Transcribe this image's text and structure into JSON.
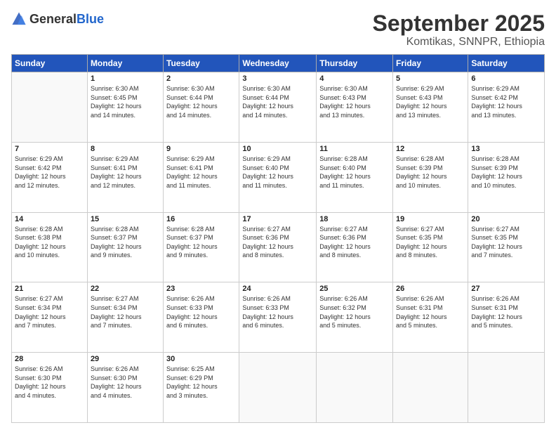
{
  "logo": {
    "general": "General",
    "blue": "Blue"
  },
  "header": {
    "month": "September 2025",
    "location": "Komtikas, SNNPR, Ethiopia"
  },
  "weekdays": [
    "Sunday",
    "Monday",
    "Tuesday",
    "Wednesday",
    "Thursday",
    "Friday",
    "Saturday"
  ],
  "weeks": [
    [
      {
        "day": "",
        "sunrise": "",
        "sunset": "",
        "daylight": ""
      },
      {
        "day": "1",
        "sunrise": "Sunrise: 6:30 AM",
        "sunset": "Sunset: 6:45 PM",
        "daylight": "Daylight: 12 hours and 14 minutes."
      },
      {
        "day": "2",
        "sunrise": "Sunrise: 6:30 AM",
        "sunset": "Sunset: 6:44 PM",
        "daylight": "Daylight: 12 hours and 14 minutes."
      },
      {
        "day": "3",
        "sunrise": "Sunrise: 6:30 AM",
        "sunset": "Sunset: 6:44 PM",
        "daylight": "Daylight: 12 hours and 14 minutes."
      },
      {
        "day": "4",
        "sunrise": "Sunrise: 6:30 AM",
        "sunset": "Sunset: 6:43 PM",
        "daylight": "Daylight: 12 hours and 13 minutes."
      },
      {
        "day": "5",
        "sunrise": "Sunrise: 6:29 AM",
        "sunset": "Sunset: 6:43 PM",
        "daylight": "Daylight: 12 hours and 13 minutes."
      },
      {
        "day": "6",
        "sunrise": "Sunrise: 6:29 AM",
        "sunset": "Sunset: 6:42 PM",
        "daylight": "Daylight: 12 hours and 13 minutes."
      }
    ],
    [
      {
        "day": "7",
        "sunrise": "Sunrise: 6:29 AM",
        "sunset": "Sunset: 6:42 PM",
        "daylight": "Daylight: 12 hours and 12 minutes."
      },
      {
        "day": "8",
        "sunrise": "Sunrise: 6:29 AM",
        "sunset": "Sunset: 6:41 PM",
        "daylight": "Daylight: 12 hours and 12 minutes."
      },
      {
        "day": "9",
        "sunrise": "Sunrise: 6:29 AM",
        "sunset": "Sunset: 6:41 PM",
        "daylight": "Daylight: 12 hours and 11 minutes."
      },
      {
        "day": "10",
        "sunrise": "Sunrise: 6:29 AM",
        "sunset": "Sunset: 6:40 PM",
        "daylight": "Daylight: 12 hours and 11 minutes."
      },
      {
        "day": "11",
        "sunrise": "Sunrise: 6:28 AM",
        "sunset": "Sunset: 6:40 PM",
        "daylight": "Daylight: 12 hours and 11 minutes."
      },
      {
        "day": "12",
        "sunrise": "Sunrise: 6:28 AM",
        "sunset": "Sunset: 6:39 PM",
        "daylight": "Daylight: 12 hours and 10 minutes."
      },
      {
        "day": "13",
        "sunrise": "Sunrise: 6:28 AM",
        "sunset": "Sunset: 6:39 PM",
        "daylight": "Daylight: 12 hours and 10 minutes."
      }
    ],
    [
      {
        "day": "14",
        "sunrise": "Sunrise: 6:28 AM",
        "sunset": "Sunset: 6:38 PM",
        "daylight": "Daylight: 12 hours and 10 minutes."
      },
      {
        "day": "15",
        "sunrise": "Sunrise: 6:28 AM",
        "sunset": "Sunset: 6:37 PM",
        "daylight": "Daylight: 12 hours and 9 minutes."
      },
      {
        "day": "16",
        "sunrise": "Sunrise: 6:28 AM",
        "sunset": "Sunset: 6:37 PM",
        "daylight": "Daylight: 12 hours and 9 minutes."
      },
      {
        "day": "17",
        "sunrise": "Sunrise: 6:27 AM",
        "sunset": "Sunset: 6:36 PM",
        "daylight": "Daylight: 12 hours and 8 minutes."
      },
      {
        "day": "18",
        "sunrise": "Sunrise: 6:27 AM",
        "sunset": "Sunset: 6:36 PM",
        "daylight": "Daylight: 12 hours and 8 minutes."
      },
      {
        "day": "19",
        "sunrise": "Sunrise: 6:27 AM",
        "sunset": "Sunset: 6:35 PM",
        "daylight": "Daylight: 12 hours and 8 minutes."
      },
      {
        "day": "20",
        "sunrise": "Sunrise: 6:27 AM",
        "sunset": "Sunset: 6:35 PM",
        "daylight": "Daylight: 12 hours and 7 minutes."
      }
    ],
    [
      {
        "day": "21",
        "sunrise": "Sunrise: 6:27 AM",
        "sunset": "Sunset: 6:34 PM",
        "daylight": "Daylight: 12 hours and 7 minutes."
      },
      {
        "day": "22",
        "sunrise": "Sunrise: 6:27 AM",
        "sunset": "Sunset: 6:34 PM",
        "daylight": "Daylight: 12 hours and 7 minutes."
      },
      {
        "day": "23",
        "sunrise": "Sunrise: 6:26 AM",
        "sunset": "Sunset: 6:33 PM",
        "daylight": "Daylight: 12 hours and 6 minutes."
      },
      {
        "day": "24",
        "sunrise": "Sunrise: 6:26 AM",
        "sunset": "Sunset: 6:33 PM",
        "daylight": "Daylight: 12 hours and 6 minutes."
      },
      {
        "day": "25",
        "sunrise": "Sunrise: 6:26 AM",
        "sunset": "Sunset: 6:32 PM",
        "daylight": "Daylight: 12 hours and 5 minutes."
      },
      {
        "day": "26",
        "sunrise": "Sunrise: 6:26 AM",
        "sunset": "Sunset: 6:31 PM",
        "daylight": "Daylight: 12 hours and 5 minutes."
      },
      {
        "day": "27",
        "sunrise": "Sunrise: 6:26 AM",
        "sunset": "Sunset: 6:31 PM",
        "daylight": "Daylight: 12 hours and 5 minutes."
      }
    ],
    [
      {
        "day": "28",
        "sunrise": "Sunrise: 6:26 AM",
        "sunset": "Sunset: 6:30 PM",
        "daylight": "Daylight: 12 hours and 4 minutes."
      },
      {
        "day": "29",
        "sunrise": "Sunrise: 6:26 AM",
        "sunset": "Sunset: 6:30 PM",
        "daylight": "Daylight: 12 hours and 4 minutes."
      },
      {
        "day": "30",
        "sunrise": "Sunrise: 6:25 AM",
        "sunset": "Sunset: 6:29 PM",
        "daylight": "Daylight: 12 hours and 3 minutes."
      },
      {
        "day": "",
        "sunrise": "",
        "sunset": "",
        "daylight": ""
      },
      {
        "day": "",
        "sunrise": "",
        "sunset": "",
        "daylight": ""
      },
      {
        "day": "",
        "sunrise": "",
        "sunset": "",
        "daylight": ""
      },
      {
        "day": "",
        "sunrise": "",
        "sunset": "",
        "daylight": ""
      }
    ]
  ]
}
